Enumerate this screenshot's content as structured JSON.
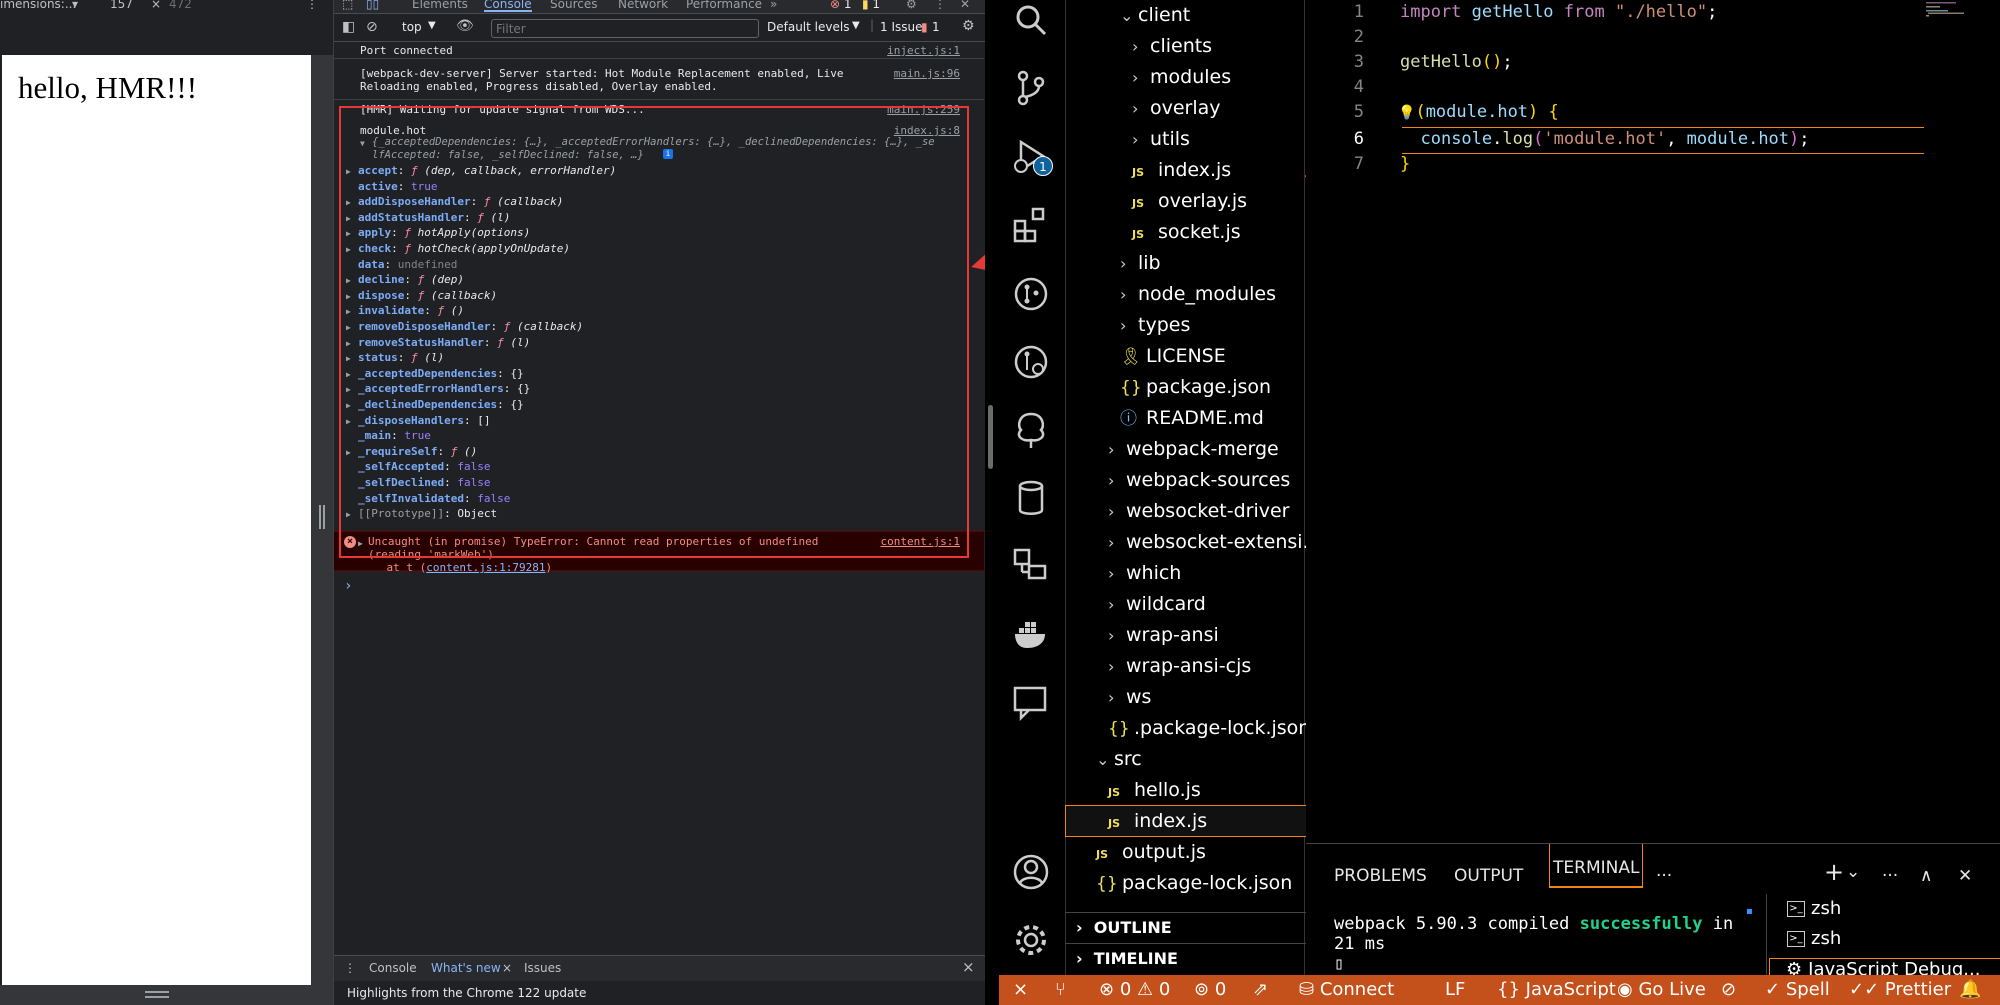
{
  "browser": {
    "devbar": {
      "dimensions": "imensions:...",
      "dropdown": "▾",
      "width": "157",
      "close": "×",
      "height": "472",
      "menu": "⋮"
    },
    "page_text": "hello, HMR!!!"
  },
  "devtools": {
    "tabs": [
      "Elements",
      "Console",
      "Sources",
      "Network",
      "Performance"
    ],
    "more_tabs": "»",
    "error_count": "1",
    "warning_count": "1",
    "toolbar": {
      "context": "top",
      "filter_placeholder": "Filter",
      "levels": "Default levels",
      "issues": "1 Issue:",
      "issues_count": "1"
    },
    "messages": [
      {
        "text": "Port connected",
        "src": "inject.js:1"
      },
      {
        "text": "[webpack-dev-server] Server started: Hot Module Replacement enabled, Live\nReloading enabled, Progress disabled, Overlay enabled.",
        "src": "main.js:96"
      },
      {
        "text": "[HMR] Waiting for update signal from WDS...",
        "src": "main.js:259"
      },
      {
        "text": "module.hot",
        "src": "index.js:8"
      }
    ],
    "object_preview": "{_acceptedDependencies: {…}, _acceptedErrorHandlers: {…}, _declinedDependencies: {…}, _se\nlfAccepted: false, _selfDeclined: false, …}",
    "properties": [
      {
        "key": "accept",
        "sep": ": ",
        "f": "ƒ",
        "val": " (dep, callback, errorHandler)",
        "type": "fn",
        "expand": true
      },
      {
        "key": "active",
        "sep": ": ",
        "f": "",
        "val": "true",
        "type": "bool",
        "expand": false
      },
      {
        "key": "addDisposeHandler",
        "sep": ": ",
        "f": "ƒ",
        "val": " (callback)",
        "type": "fn",
        "expand": true
      },
      {
        "key": "addStatusHandler",
        "sep": ": ",
        "f": "ƒ",
        "val": " (l)",
        "type": "fn",
        "expand": true
      },
      {
        "key": "apply",
        "sep": ": ",
        "f": "ƒ",
        "val": " hotApply(options)",
        "type": "fn",
        "expand": true
      },
      {
        "key": "check",
        "sep": ": ",
        "f": "ƒ",
        "val": " hotCheck(applyOnUpdate)",
        "type": "fn",
        "expand": true
      },
      {
        "key": "data",
        "sep": ": ",
        "f": "",
        "val": "undefined",
        "type": "undef",
        "expand": false
      },
      {
        "key": "decline",
        "sep": ": ",
        "f": "ƒ",
        "val": " (dep)",
        "type": "fn",
        "expand": true
      },
      {
        "key": "dispose",
        "sep": ": ",
        "f": "ƒ",
        "val": " (callback)",
        "type": "fn",
        "expand": true
      },
      {
        "key": "invalidate",
        "sep": ": ",
        "f": "ƒ",
        "val": " ()",
        "type": "fn",
        "expand": true
      },
      {
        "key": "removeDisposeHandler",
        "sep": ": ",
        "f": "ƒ",
        "val": " (callback)",
        "type": "fn",
        "expand": true
      },
      {
        "key": "removeStatusHandler",
        "sep": ": ",
        "f": "ƒ",
        "val": " (l)",
        "type": "fn",
        "expand": true
      },
      {
        "key": "status",
        "sep": ": ",
        "f": "ƒ",
        "val": " (l)",
        "type": "fn",
        "expand": true
      },
      {
        "key": "_acceptedDependencies",
        "sep": ": ",
        "f": "",
        "val": "{}",
        "type": "plain",
        "expand": true
      },
      {
        "key": "_acceptedErrorHandlers",
        "sep": ": ",
        "f": "",
        "val": "{}",
        "type": "plain",
        "expand": true
      },
      {
        "key": "_declinedDependencies",
        "sep": ": ",
        "f": "",
        "val": "{}",
        "type": "plain",
        "expand": true
      },
      {
        "key": "_disposeHandlers",
        "sep": ": ",
        "f": "",
        "val": "[]",
        "type": "plain",
        "expand": true
      },
      {
        "key": "_main",
        "sep": ": ",
        "f": "",
        "val": "true",
        "type": "bool",
        "expand": false
      },
      {
        "key": "_requireSelf",
        "sep": ": ",
        "f": "ƒ",
        "val": " ()",
        "type": "fn",
        "expand": true
      },
      {
        "key": "_selfAccepted",
        "sep": ": ",
        "f": "",
        "val": "false",
        "type": "bool",
        "expand": false
      },
      {
        "key": "_selfDeclined",
        "sep": ": ",
        "f": "",
        "val": "false",
        "type": "bool",
        "expand": false
      },
      {
        "key": "_selfInvalidated",
        "sep": ": ",
        "f": "",
        "val": "false",
        "type": "bool",
        "expand": false
      },
      {
        "key": "[[Prototype]]",
        "sep": ": ",
        "f": "",
        "val": "Object",
        "type": "plain",
        "expand": true,
        "dim": true
      }
    ],
    "error": {
      "text": "Uncaught (in promise) TypeError: Cannot read properties of undefined\n(reading 'markWeb')",
      "src": "content.js:1",
      "stack_prefix": "    at t (",
      "stack_link": "content.js:1:79281",
      "stack_suffix": ")"
    },
    "prompt": "›",
    "drawer": {
      "tabs": [
        "Console",
        "What's new",
        "Issues"
      ],
      "close": "×",
      "body": "Highlights from the Chrome 122 update"
    }
  },
  "vscode": {
    "explorer": [
      {
        "label": "client",
        "chev": "⌄",
        "kind": "folder",
        "depth": 1
      },
      {
        "label": "clients",
        "chev": "›",
        "kind": "folder",
        "depth": 2
      },
      {
        "label": "modules",
        "chev": "›",
        "kind": "folder",
        "depth": 2
      },
      {
        "label": "overlay",
        "chev": "›",
        "kind": "folder",
        "depth": 2
      },
      {
        "label": "utils",
        "chev": "›",
        "kind": "folder",
        "depth": 2
      },
      {
        "label": "index.js",
        "chev": "",
        "kind": "js",
        "depth": 2
      },
      {
        "label": "overlay.js",
        "chev": "",
        "kind": "js",
        "depth": 2
      },
      {
        "label": "socket.js",
        "chev": "",
        "kind": "js",
        "depth": 2
      },
      {
        "label": "lib",
        "chev": "›",
        "kind": "folder",
        "depth": 1
      },
      {
        "label": "node_modules",
        "chev": "›",
        "kind": "folder",
        "depth": 1
      },
      {
        "label": "types",
        "chev": "›",
        "kind": "folder",
        "depth": 1
      },
      {
        "label": "LICENSE",
        "chev": "",
        "kind": "license",
        "depth": 1
      },
      {
        "label": "package.json",
        "chev": "",
        "kind": "json",
        "depth": 1
      },
      {
        "label": "README.md",
        "chev": "",
        "kind": "info",
        "depth": 1
      },
      {
        "label": "webpack-merge",
        "chev": "›",
        "kind": "folder",
        "depth": 0
      },
      {
        "label": "webpack-sources",
        "chev": "›",
        "kind": "folder",
        "depth": 0
      },
      {
        "label": "websocket-driver",
        "chev": "›",
        "kind": "folder",
        "depth": 0
      },
      {
        "label": "websocket-extensi...",
        "chev": "›",
        "kind": "folder",
        "depth": 0
      },
      {
        "label": "which",
        "chev": "›",
        "kind": "folder",
        "depth": 0
      },
      {
        "label": "wildcard",
        "chev": "›",
        "kind": "folder",
        "depth": 0
      },
      {
        "label": "wrap-ansi",
        "chev": "›",
        "kind": "folder",
        "depth": 0
      },
      {
        "label": "wrap-ansi-cjs",
        "chev": "›",
        "kind": "folder",
        "depth": 0
      },
      {
        "label": "ws",
        "chev": "›",
        "kind": "folder",
        "depth": 0
      },
      {
        "label": ".package-lock.json",
        "chev": "",
        "kind": "json",
        "depth": 0
      },
      {
        "label": "src",
        "chev": "⌄",
        "kind": "folder",
        "depth": -1
      },
      {
        "label": "hello.js",
        "chev": "",
        "kind": "js",
        "depth": 0
      },
      {
        "label": "index.js",
        "chev": "",
        "kind": "js",
        "depth": 0,
        "selected": true
      },
      {
        "label": "output.js",
        "chev": "",
        "kind": "js",
        "depth": -1
      },
      {
        "label": "package-lock.json",
        "chev": "",
        "kind": "json",
        "depth": -1
      }
    ],
    "sections": {
      "outline": "OUTLINE",
      "timeline": "TIMELINE",
      "chevron": "›"
    },
    "editor": {
      "line_numbers": [
        "1",
        "2",
        "3",
        "4",
        "5",
        "6",
        "7"
      ],
      "l1": {
        "kw1": "import",
        "id": " getHello ",
        "kw2": "from",
        "str": " \"./hello\"",
        "end": ";"
      },
      "l3": {
        "fn": "getHello",
        "paren": "()",
        "end": ";"
      },
      "l5": {
        "bulb": "💡",
        "kw": "if",
        "open": "(",
        "expr": "module.hot",
        "close": ")",
        "brace": " {"
      },
      "l6": {
        "indent": "  ",
        "obj": "console",
        "dot": ".",
        "fn": "log",
        "open": "(",
        "str": "'module.hot'",
        "comma": ", ",
        "arg": "module.hot",
        "close": ")",
        "end": ";"
      },
      "l7": {
        "brace": "}"
      }
    },
    "panel": {
      "tabs": [
        "PROBLEMS",
        "OUTPUT",
        "TERMINAL"
      ],
      "more": "···",
      "add": "+",
      "add_menu": "⌄",
      "menu": "···",
      "maximize": "∧",
      "close": "✕",
      "terminal_line1_pre": "webpack 5.90.3 compiled ",
      "terminal_ok": "successfully",
      "terminal_line1_post": " in",
      "terminal_line2": "21 ms",
      "cursor": "▯",
      "terminals": [
        "zsh",
        "zsh",
        "JavaScript Debug..."
      ],
      "terminal_glyph": ">_"
    },
    "statusbar": {
      "remote": "⨯",
      "errors": "0",
      "warnings": "0",
      "ports": "0",
      "connect": "Connect",
      "eol": "LF",
      "language": "JavaScript",
      "golive": "Go Live",
      "spell": "Spell",
      "prettier": "Prettier"
    },
    "debug_badge": "1"
  },
  "colors": {
    "highlight": "#e53935",
    "status_bar": "#c4501b",
    "accent_orange": "#f38518"
  }
}
